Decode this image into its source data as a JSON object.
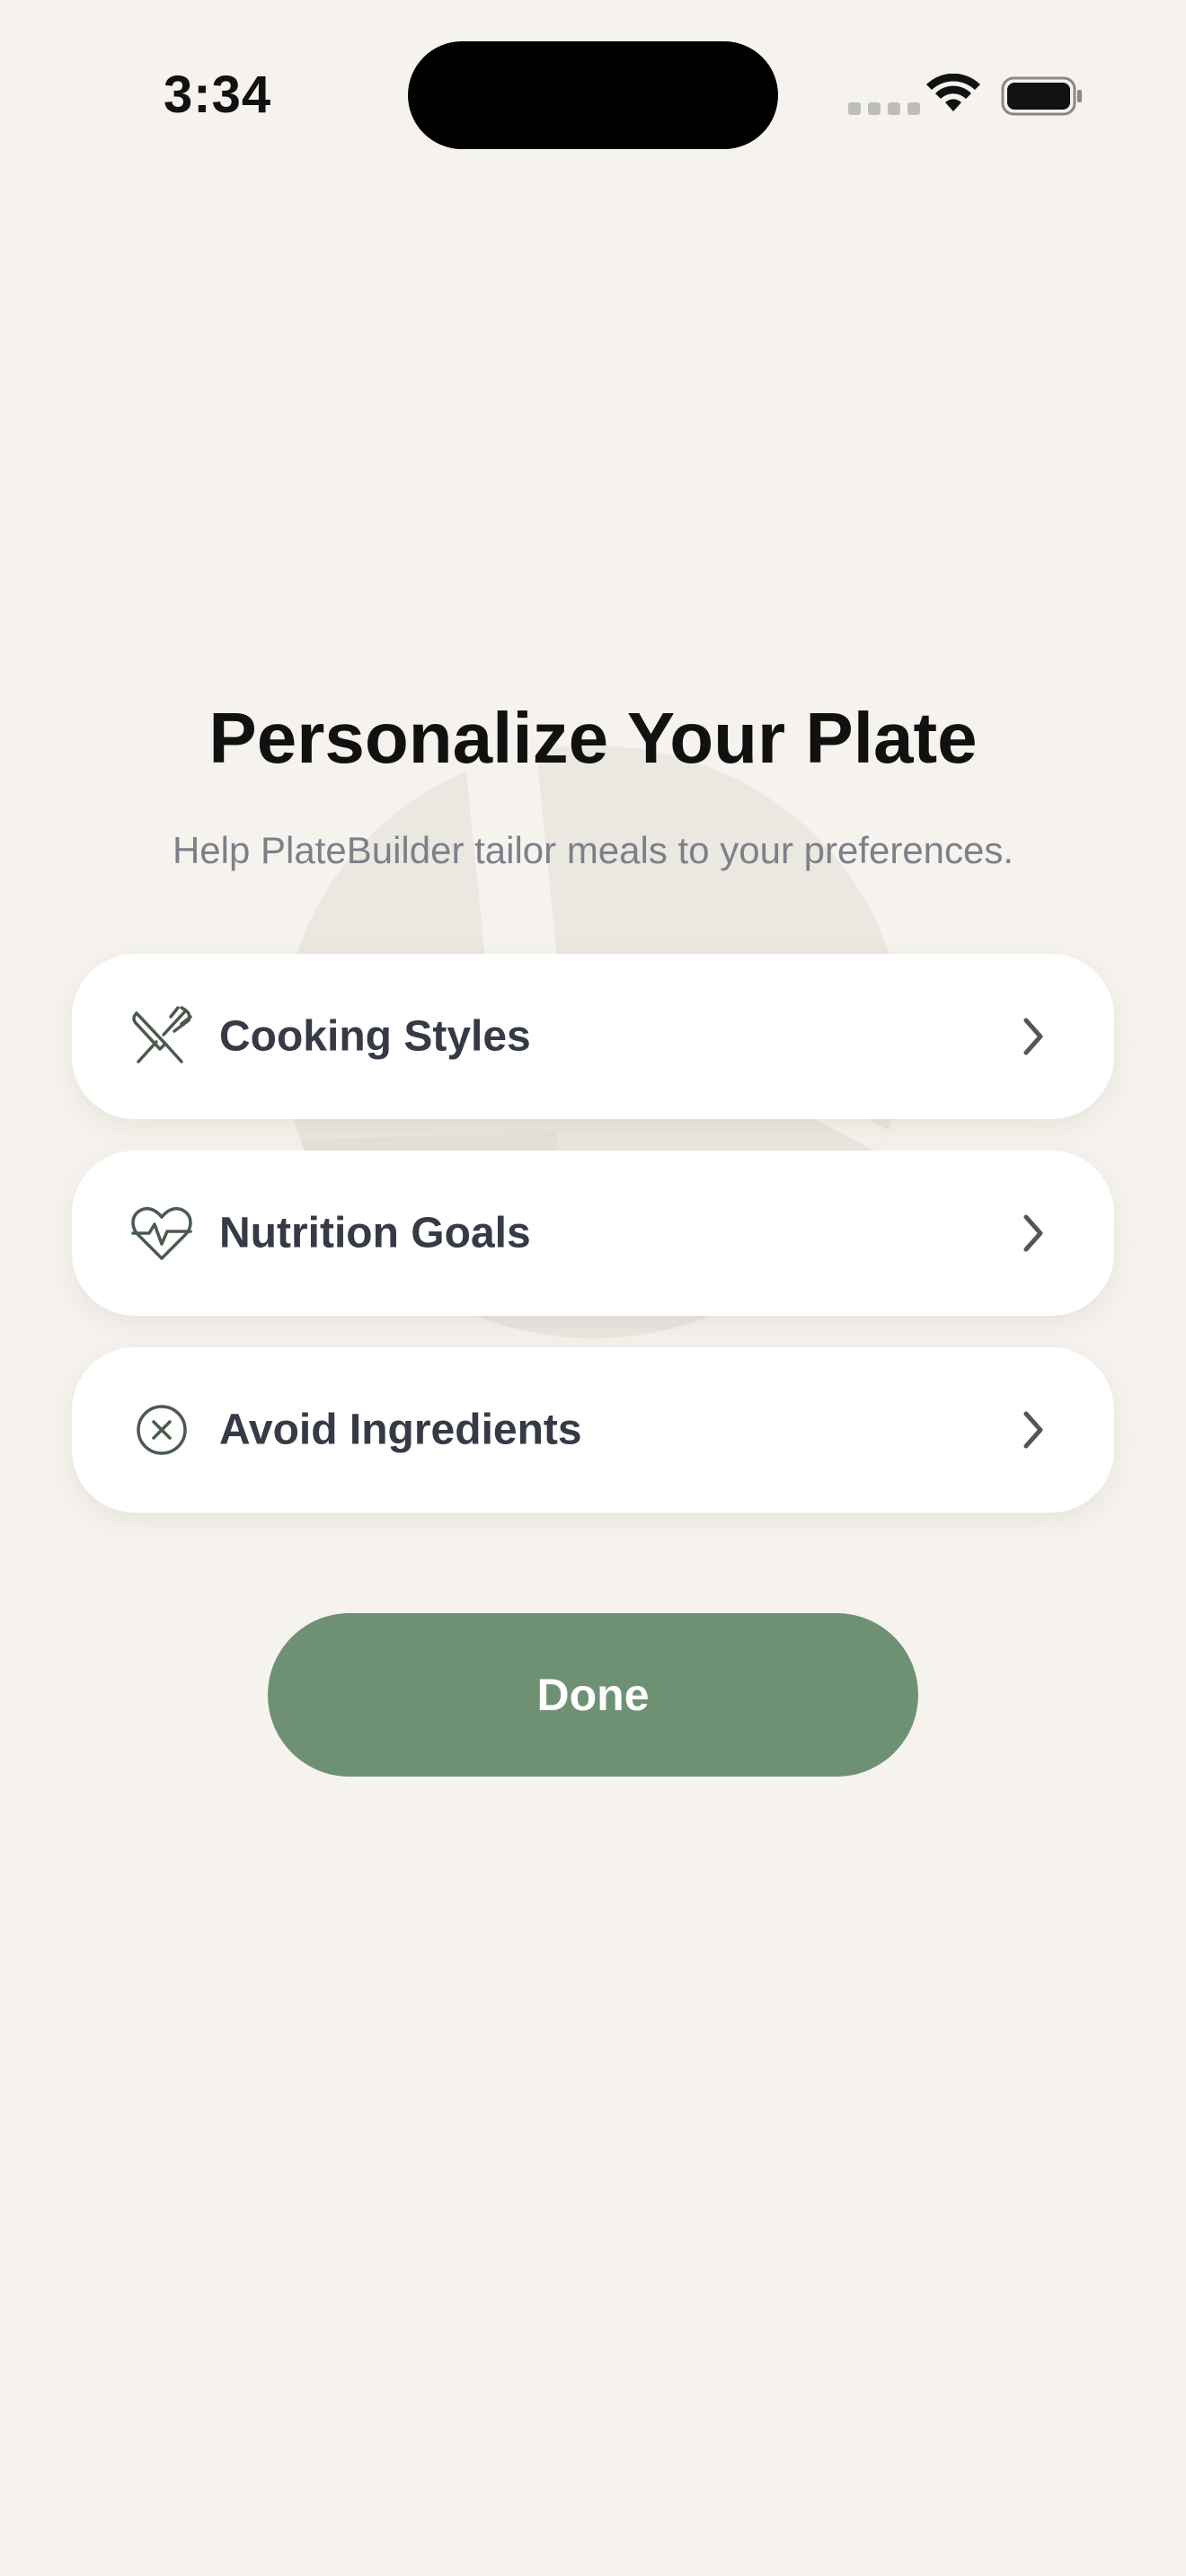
{
  "status_bar": {
    "time": "3:34",
    "icons": [
      "signal-dots-icon",
      "wifi-icon",
      "battery-icon"
    ]
  },
  "header": {
    "title": "Personalize Your Plate",
    "subtitle": "Help PlateBuilder tailor meals to your preferences."
  },
  "options": [
    {
      "label": "Cooking Styles",
      "icon": "fork-knife-icon"
    },
    {
      "label": "Nutrition Goals",
      "icon": "heart-pulse-icon"
    },
    {
      "label": "Avoid Ingredients",
      "icon": "x-circle-icon"
    }
  ],
  "actions": {
    "done_label": "Done"
  },
  "colors": {
    "background": "#F6F3EE",
    "accent": "#6F9173",
    "card": "#FFFFFF",
    "label_text": "#363A46",
    "subtitle_text": "#7C808A"
  }
}
